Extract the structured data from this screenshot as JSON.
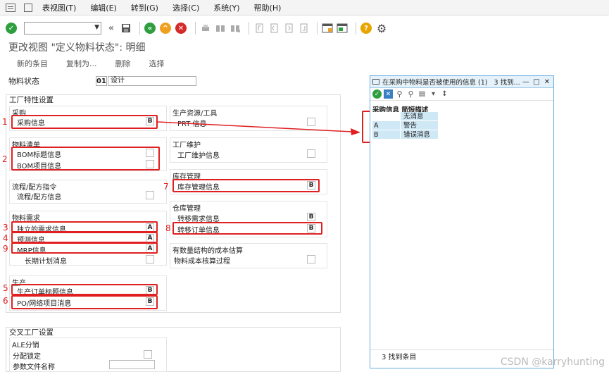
{
  "menubar": {
    "items": [
      "表视图(T)",
      "编辑(E)",
      "转到(G)",
      "选择(C)",
      "系统(Y)",
      "帮助(H)"
    ]
  },
  "toolbar": {
    "icons": [
      "enter-icon",
      "command-field",
      "back-icon",
      "save-icon",
      "back-nav-icon",
      "exit-icon",
      "cancel-icon",
      "print-icon",
      "find-icon",
      "find-next-icon",
      "first-page-icon",
      "prev-page-icon",
      "next-page-icon",
      "last-page-icon",
      "new-session-icon",
      "shortcut-icon",
      "help-icon",
      "settings-icon"
    ],
    "colors": {
      "green": "#2e9e3f",
      "orange": "#f0a020",
      "red": "#d42a2a",
      "help": "#e8a500"
    }
  },
  "title": "更改视图 \"定义物料状态\": 明细",
  "actions": [
    "新的条目",
    "复制为...",
    "删除",
    "选择"
  ],
  "material_status": {
    "label": "物料状态",
    "code": "01",
    "value": "设计"
  },
  "plant": {
    "title": "工厂特性设置",
    "purchasing": {
      "title": "采购",
      "label": "采购信息",
      "value": "B"
    },
    "bom": {
      "title": "物料清单",
      "row1": "BOM标题信息",
      "row2": "BOM项目信息"
    },
    "routing": {
      "title": "流程/配方指令",
      "label": "流程/配方信息"
    },
    "mrp": {
      "title": "物料需求",
      "r1": "独立的需求信息",
      "v1": "A",
      "r2": "预测信息",
      "v2": "A",
      "r3": "MRP信息",
      "v3": "A",
      "r4": "长期计划消息"
    },
    "production": {
      "title": "生产",
      "r1": "生产订单标题信息",
      "v1": "B",
      "r2": "PO/网络项目消息",
      "v2": "B"
    },
    "prt": {
      "title": "生产资源/工具",
      "label": "PRT 信息"
    },
    "maintenance": {
      "title": "工厂维护",
      "label": "工厂维护信息"
    },
    "inventory": {
      "title": "库存管理",
      "label": "库存管理信息",
      "value": "B"
    },
    "warehouse": {
      "title": "仓库管理",
      "r1": "转移需求信息",
      "v1": "B",
      "r2": "转移订单信息",
      "v2": "B"
    },
    "costing": {
      "title": "有数量结构的成本估算",
      "label": "物料成本核算过程"
    }
  },
  "cross_plant": {
    "title": "交叉工厂设置",
    "ale": {
      "title": "ALE分销",
      "r1": "分配锁定",
      "r2": "参数文件名称"
    }
  },
  "annotations": [
    "1",
    "2",
    "3",
    "4",
    "9",
    "5",
    "6",
    "7",
    "8"
  ],
  "popup": {
    "title": "在采购中物料是否被使用的信息 (1)",
    "count_text": "3 找到...",
    "columns": "采购信息 简短描述",
    "rows": [
      {
        "code": "",
        "desc": "无消息"
      },
      {
        "code": "A",
        "desc": "警告"
      },
      {
        "code": "B",
        "desc": "错误消息"
      }
    ],
    "footer": "3 找到条目"
  },
  "watermark": "CSDN @karryhunting"
}
